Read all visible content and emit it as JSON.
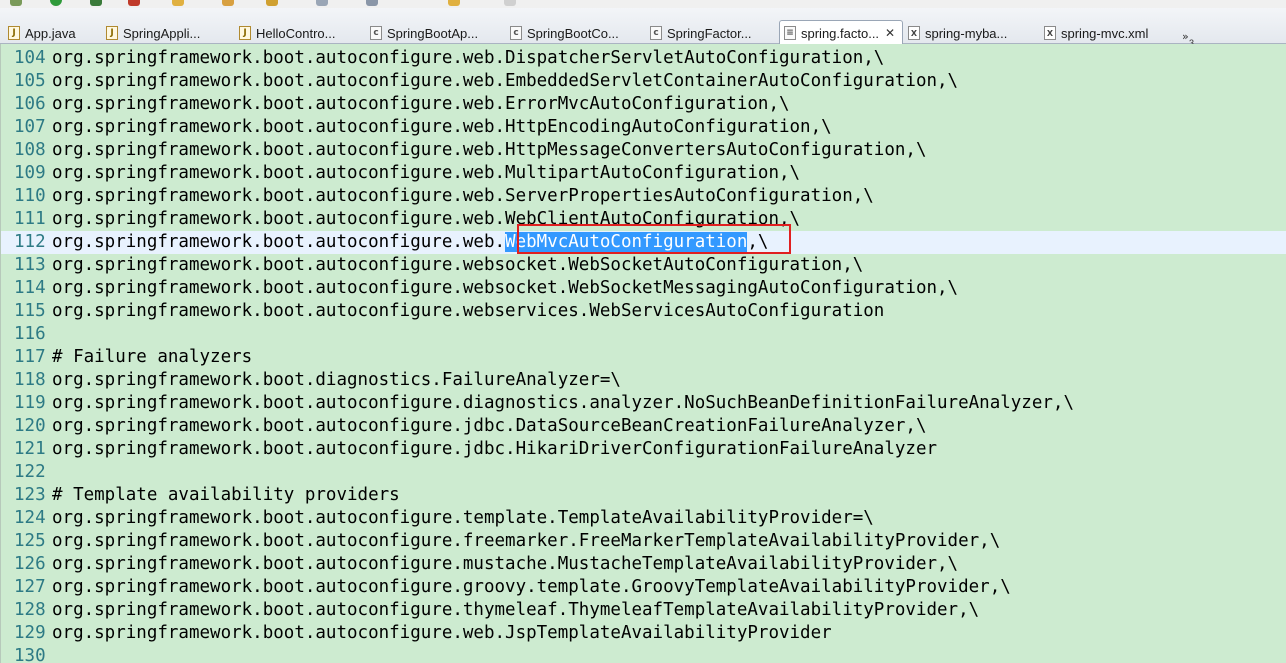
{
  "tabs": [
    {
      "label": "App.java",
      "icon": "java-file-icon"
    },
    {
      "label": "SpringAppli...",
      "icon": "java-file-icon"
    },
    {
      "label": "HelloContro...",
      "icon": "java-file-icon"
    },
    {
      "label": "SpringBootAp...",
      "icon": "class-file-icon"
    },
    {
      "label": "SpringBootCo...",
      "icon": "class-file-icon"
    },
    {
      "label": "SpringFactor...",
      "icon": "class-file-icon"
    },
    {
      "label": "spring.facto...",
      "icon": "text-file-icon",
      "active": true
    },
    {
      "label": "spring-myba...",
      "icon": "xml-file-icon"
    },
    {
      "label": "spring-mvc.xml",
      "icon": "xml-file-icon"
    }
  ],
  "tab_close_glyph": "✕",
  "tab_overflow_count": "3",
  "editor": {
    "lines": [
      {
        "num": "104",
        "text": "org.springframework.boot.autoconfigure.web.DispatcherServletAutoConfiguration,\\"
      },
      {
        "num": "105",
        "text": "org.springframework.boot.autoconfigure.web.EmbeddedServletContainerAutoConfiguration,\\"
      },
      {
        "num": "106",
        "text": "org.springframework.boot.autoconfigure.web.ErrorMvcAutoConfiguration,\\"
      },
      {
        "num": "107",
        "text": "org.springframework.boot.autoconfigure.web.HttpEncodingAutoConfiguration,\\"
      },
      {
        "num": "108",
        "text": "org.springframework.boot.autoconfigure.web.HttpMessageConvertersAutoConfiguration,\\"
      },
      {
        "num": "109",
        "text": "org.springframework.boot.autoconfigure.web.MultipartAutoConfiguration,\\"
      },
      {
        "num": "110",
        "text": "org.springframework.boot.autoconfigure.web.ServerPropertiesAutoConfiguration,\\"
      },
      {
        "num": "111",
        "text": "org.springframework.boot.autoconfigure.web.WebClientAutoConfiguration,\\"
      },
      {
        "num": "112",
        "pre": "org.springframework.boot.autoconfigure.web.",
        "selected": "WebMvcAutoConfiguration",
        "post": ",\\",
        "current": true
      },
      {
        "num": "113",
        "text": "org.springframework.boot.autoconfigure.websocket.WebSocketAutoConfiguration,\\"
      },
      {
        "num": "114",
        "text": "org.springframework.boot.autoconfigure.websocket.WebSocketMessagingAutoConfiguration,\\"
      },
      {
        "num": "115",
        "text": "org.springframework.boot.autoconfigure.webservices.WebServicesAutoConfiguration"
      },
      {
        "num": "116",
        "text": ""
      },
      {
        "num": "117",
        "text": "# Failure analyzers"
      },
      {
        "num": "118",
        "text": "org.springframework.boot.diagnostics.FailureAnalyzer=\\"
      },
      {
        "num": "119",
        "text": "org.springframework.boot.autoconfigure.diagnostics.analyzer.NoSuchBeanDefinitionFailureAnalyzer,\\"
      },
      {
        "num": "120",
        "text": "org.springframework.boot.autoconfigure.jdbc.DataSourceBeanCreationFailureAnalyzer,\\"
      },
      {
        "num": "121",
        "text": "org.springframework.boot.autoconfigure.jdbc.HikariDriverConfigurationFailureAnalyzer"
      },
      {
        "num": "122",
        "text": ""
      },
      {
        "num": "123",
        "text": "# Template availability providers"
      },
      {
        "num": "124",
        "text": "org.springframework.boot.autoconfigure.template.TemplateAvailabilityProvider=\\"
      },
      {
        "num": "125",
        "text": "org.springframework.boot.autoconfigure.freemarker.FreeMarkerTemplateAvailabilityProvider,\\"
      },
      {
        "num": "126",
        "text": "org.springframework.boot.autoconfigure.mustache.MustacheTemplateAvailabilityProvider,\\"
      },
      {
        "num": "127",
        "text": "org.springframework.boot.autoconfigure.groovy.template.GroovyTemplateAvailabilityProvider,\\"
      },
      {
        "num": "128",
        "text": "org.springframework.boot.autoconfigure.thymeleaf.ThymeleafTemplateAvailabilityProvider,\\"
      },
      {
        "num": "129",
        "text": "org.springframework.boot.autoconfigure.web.JspTemplateAvailabilityProvider"
      },
      {
        "num": "130",
        "text": ""
      }
    ]
  },
  "colors": {
    "editor_background": "#cdebd0",
    "line_number": "#2d7a85",
    "current_line": "#e8f2fe",
    "selection": "#3399ff",
    "highlight_box": "#e02020"
  }
}
